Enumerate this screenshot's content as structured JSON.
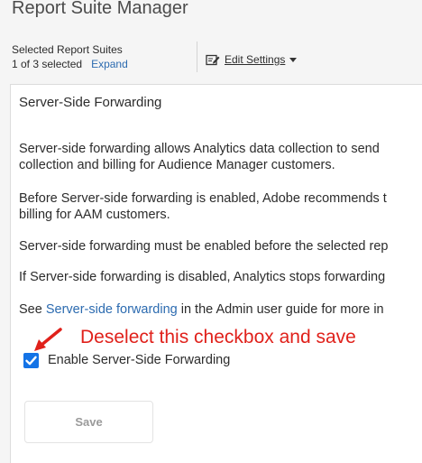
{
  "header": {
    "app_title": "Report Suite Manager"
  },
  "selection": {
    "label": "Selected Report Suites",
    "count_text": "1 of 3 selected",
    "expand_label": "Expand"
  },
  "toolbar": {
    "edit_settings_label": "Edit Settings",
    "edit_icon": "edit-icon",
    "dropdown_icon": "caret-down-icon"
  },
  "panel": {
    "title": "Server-Side Forwarding",
    "paragraphs": {
      "p1_line1": "Server-side forwarding allows Analytics data collection to send",
      "p1_line2": "collection and billing for Audience Manager customers.",
      "p2_line1": "Before Server-side forwarding is enabled, Adobe recommends t",
      "p2_line2": "billing for AAM customers.",
      "p3": "Server-side forwarding must be enabled before the selected rep",
      "p4": "If Server-side forwarding is disabled, Analytics stops forwarding",
      "p5_prefix": "See ",
      "p5_link": "Server-side forwarding",
      "p5_suffix": " in the Admin user guide for more in"
    },
    "checkbox": {
      "label": "Enable Server-Side Forwarding",
      "checked": true
    },
    "save_label": "Save"
  },
  "annotation": {
    "text": "Deselect this checkbox and save",
    "color": "#e0211b"
  },
  "colors": {
    "link": "#2c6bb0",
    "checkbox": "#1473e6"
  }
}
